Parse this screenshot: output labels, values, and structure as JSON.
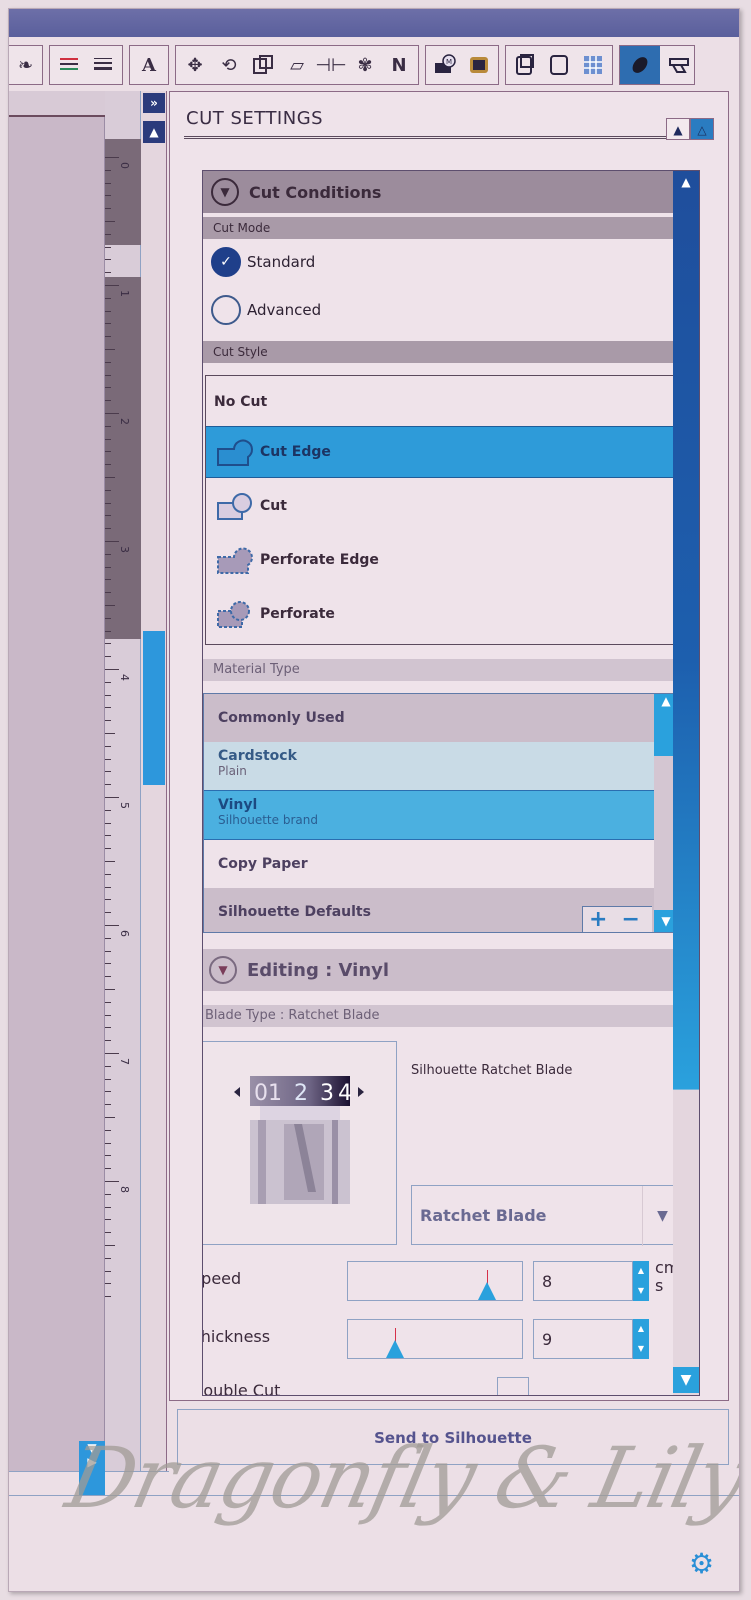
{
  "toolbar": {
    "groups": [
      [
        "partial-icon"
      ],
      [
        "line-color-icon",
        "line-style-icon"
      ],
      [
        "text-icon"
      ],
      [
        "replicate-icon",
        "rotate-icon",
        "modify-icon",
        "offset-icon",
        "align-icon",
        "trace-icon",
        "knife-icon"
      ],
      [
        "media-icon",
        "store-icon"
      ],
      [
        "page-setup-icon",
        "registration-icon",
        "grid-icon"
      ],
      [
        "cut-settings-icon",
        "send-icon"
      ]
    ],
    "text_icon_glyph": "A",
    "active": "cut-settings-icon"
  },
  "left": {
    "expand_glyph": "»",
    "scroll_up_glyph": "▲",
    "ruler_numbers": [
      "0",
      "1",
      "2",
      "3",
      "4",
      "5",
      "6",
      "7",
      "8"
    ]
  },
  "panel": {
    "title": "CUT SETTINGS",
    "cut_conditions": {
      "title": "Cut Conditions",
      "cut_mode_label": "Cut Mode",
      "modes": [
        {
          "label": "Standard",
          "selected": true
        },
        {
          "label": "Advanced",
          "selected": false
        }
      ],
      "cut_style_label": "Cut Style",
      "styles": [
        {
          "label": "No Cut",
          "icon": "no-cut-icon",
          "selected": false
        },
        {
          "label": "Cut Edge",
          "icon": "cut-edge-icon",
          "selected": true
        },
        {
          "label": "Cut",
          "icon": "cut-icon",
          "selected": false
        },
        {
          "label": "Perforate Edge",
          "icon": "perforate-edge-icon",
          "selected": false
        },
        {
          "label": "Perforate",
          "icon": "perforate-icon",
          "selected": false
        }
      ]
    },
    "material": {
      "label": "Material Type",
      "items": [
        {
          "label": "Commonly Used",
          "kind": "group"
        },
        {
          "label": "Cardstock",
          "sub": "Plain",
          "kind": "item"
        },
        {
          "label": "Vinyl",
          "sub": "Silhouette brand",
          "kind": "selected"
        },
        {
          "label": "Copy Paper",
          "kind": "item"
        },
        {
          "label": "Silhouette Defaults",
          "kind": "group"
        }
      ],
      "add_glyph": "+",
      "remove_glyph": "−"
    },
    "editing": {
      "title": "Editing : Vinyl",
      "blade_type_label": "Blade Type : Ratchet Blade",
      "blade_name": "Silhouette Ratchet Blade",
      "blade_scale": [
        "0",
        "1",
        "2",
        "3",
        "4"
      ],
      "blade_select": "Ratchet Blade",
      "speed": {
        "label": "Speed",
        "value": "8",
        "unit": "cm/\ns",
        "slider_fraction": 0.8
      },
      "thickness": {
        "label": "Thickness",
        "value": "9",
        "slider_fraction": 0.27
      },
      "double_cut_label": "Double Cut"
    },
    "send_button": "Send to Silhouette"
  },
  "watermark": "Dragonfly & Lily Pads",
  "colors": {
    "accent": "#2aa1dd",
    "dark_accent": "#1f3f8a",
    "selected_row": "#2e9bd9"
  }
}
